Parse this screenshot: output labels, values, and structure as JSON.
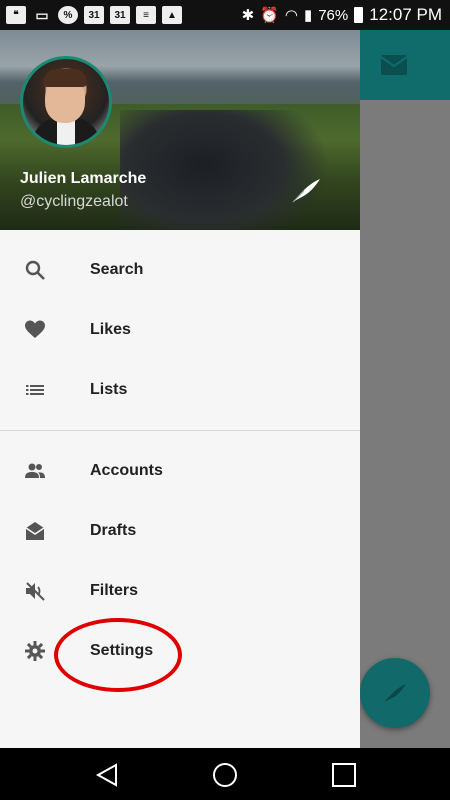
{
  "status_bar": {
    "notification_icons": [
      "hangouts-icon",
      "cast-icon",
      "percent-icon",
      "calendar-icon",
      "calendar-icon",
      "message-icon",
      "image-icon"
    ],
    "calendar_day_1": "31",
    "calendar_day_2": "31",
    "percent_symbol": "%",
    "battery_level": "76%",
    "time": "12:07 PM"
  },
  "drawer": {
    "user_name": "Julien Lamarche",
    "user_handle": "@cyclingzealot",
    "menu_primary": [
      {
        "icon": "search-icon",
        "label": "Search"
      },
      {
        "icon": "heart-icon",
        "label": "Likes"
      },
      {
        "icon": "list-icon",
        "label": "Lists"
      }
    ],
    "menu_secondary": [
      {
        "icon": "accounts-icon",
        "label": "Accounts"
      },
      {
        "icon": "drafts-icon",
        "label": "Drafts"
      },
      {
        "icon": "mute-icon",
        "label": "Filters"
      },
      {
        "icon": "gear-icon",
        "label": "Settings"
      }
    ]
  },
  "colors": {
    "accent": "#0f6c6a",
    "annotation": "#e00000"
  }
}
